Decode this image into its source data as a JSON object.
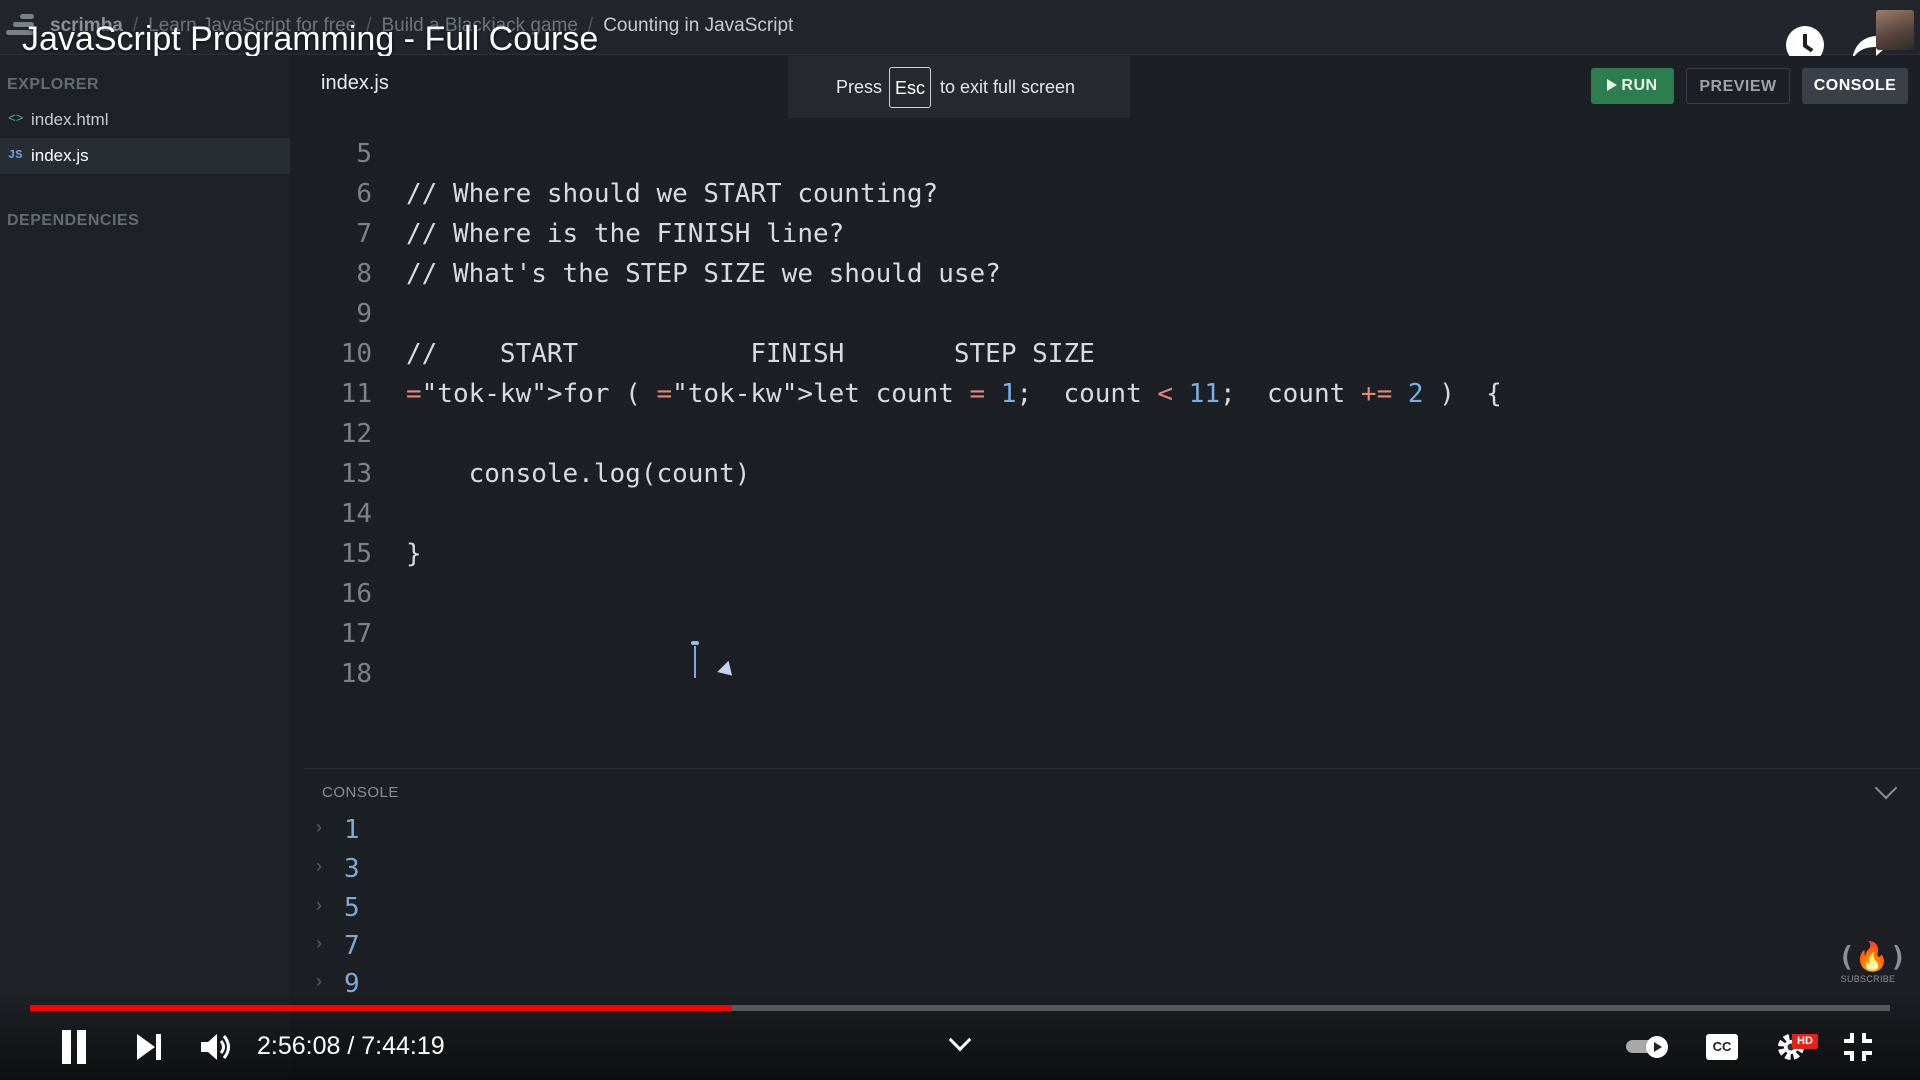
{
  "breadcrumb": {
    "brand": "scrimba",
    "items": [
      "Learn JavaScript for free",
      "Build a Blackjack game"
    ],
    "current": "Counting in JavaScript"
  },
  "video": {
    "title": "JavaScript Programming - Full Course",
    "current_time": "2:56:08",
    "duration": "7:44:19",
    "time_display": "2:56:08 / 7:44:19",
    "progress_fraction": 0.3776
  },
  "sidebar": {
    "explorer_heading": "EXPLORER",
    "files": [
      {
        "label": "index.html",
        "icon": "html-file-icon",
        "active": false
      },
      {
        "label": "index.js",
        "icon": "js-file-icon",
        "active": true
      }
    ],
    "dependencies_heading": "DEPENDENCIES"
  },
  "editor": {
    "tab_label": "index.js",
    "lines": [
      {
        "number": "5",
        "text": "// Where should we START counting?"
      },
      {
        "number": "6",
        "text": "// Where is the FINISH line?"
      },
      {
        "number": "7",
        "text": "// What's the STEP SIZE we should use?"
      },
      {
        "number": "8",
        "text": ""
      },
      {
        "number": "9",
        "text": "//    START           FINISH       STEP SIZE"
      },
      {
        "number": "10",
        "text": "for ( let count = 1;  count < 11;  count += 2 )  {"
      },
      {
        "number": "11",
        "text": ""
      },
      {
        "number": "12",
        "text": "    console.log(count)"
      },
      {
        "number": "13",
        "text": ""
      },
      {
        "number": "14",
        "text": "}"
      },
      {
        "number": "15",
        "text": ""
      },
      {
        "number": "16",
        "text": ""
      },
      {
        "number": "17",
        "text": ""
      },
      {
        "number": "18",
        "text": ""
      }
    ]
  },
  "toolbar": {
    "run_label": "RUN",
    "preview_label": "PREVIEW",
    "console_label": "CONSOLE"
  },
  "fullscreen_toast": {
    "prefix": "Press",
    "key": "Esc",
    "suffix": "to exit full screen"
  },
  "console": {
    "heading": "CONSOLE",
    "outputs": [
      "1",
      "3",
      "5",
      "7",
      "9"
    ]
  },
  "channel_badge": {
    "glyph": "(🔥)",
    "caption": "SUBSCRIBE"
  },
  "player": {
    "cc_label": "CC",
    "hd_label": "HD"
  },
  "colors": {
    "accent_run": "#2e7d4f",
    "progress": "#ff0000",
    "keyword": "#e58979",
    "number": "#79b0e8"
  }
}
